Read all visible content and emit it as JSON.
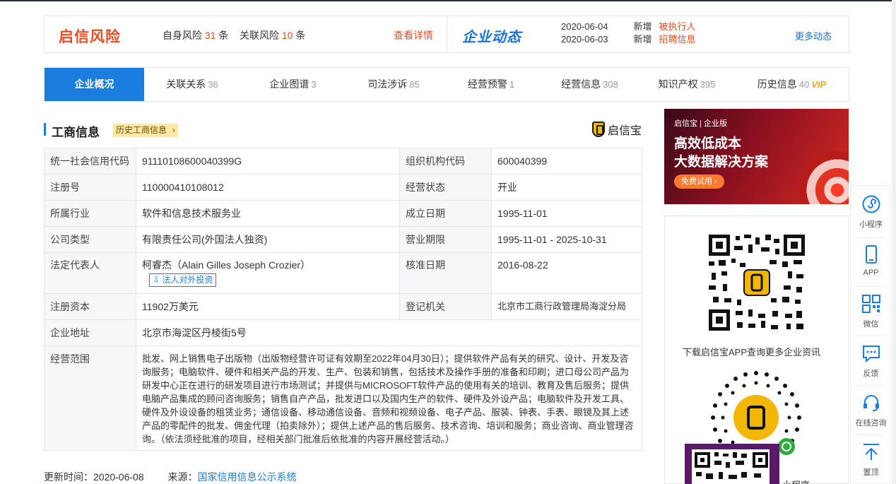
{
  "risk": {
    "logo": "启信风险",
    "self_label": "自身风险",
    "self_count": "31",
    "related_label": "关联风险",
    "related_count": "10",
    "unit": "条",
    "detail": "查看详情"
  },
  "dynamics": {
    "logo": "企业动态",
    "rows": [
      {
        "date": "2020-06-04",
        "tag": "新增",
        "text": "被执行人"
      },
      {
        "date": "2020-06-03",
        "tag": "新增",
        "text": "招聘信息"
      }
    ],
    "more": "更多动态"
  },
  "tabs": [
    {
      "label": "企业概况",
      "count": ""
    },
    {
      "label": "关联关系",
      "count": "36"
    },
    {
      "label": "企业图谱",
      "count": "3"
    },
    {
      "label": "司法涉诉",
      "count": "85"
    },
    {
      "label": "经营预警",
      "count": "1"
    },
    {
      "label": "经营信息",
      "count": "308"
    },
    {
      "label": "知识产权",
      "count": "395"
    },
    {
      "label": "历史信息",
      "count": "40",
      "badge": "VIP"
    }
  ],
  "section": {
    "title": "工商信息",
    "history_btn": "历史工商信息",
    "brand": "启信宝"
  },
  "info": {
    "credit_code_label": "统一社会信用代码",
    "credit_code": "91110108600040399G",
    "org_code_label": "组织机构代码",
    "org_code": "600040399",
    "reg_no_label": "注册号",
    "reg_no": "110000410108012",
    "status_label": "经营状态",
    "status": "开业",
    "industry_label": "所属行业",
    "industry": "软件和信息技术服务业",
    "founded_label": "成立日期",
    "founded": "1995-11-01",
    "type_label": "公司类型",
    "type": "有限责任公司(外国法人独资)",
    "term_label": "营业期限",
    "term": "1995-11-01 - 2025-10-31",
    "legal_label": "法定代表人",
    "legal": "柯睿杰（Alain Gilles Joseph Crozier）",
    "invest_btn": "法人对外投资",
    "approval_label": "核准日期",
    "approval": "2016-08-22",
    "capital_label": "注册资本",
    "capital": "11902万美元",
    "authority_label": "登记机关",
    "authority": "北京市工商行政管理局海淀分局",
    "address_label": "企业地址",
    "address": "北京市海淀区丹棱街5号",
    "scope_label": "经营范围",
    "scope": "批发、网上销售电子出版物（出版物经营许可证有效期至2022年04月30日）；提供软件产品有关的研究、设计、开发及咨询服务；电脑软件、硬件和相关产品的开发、生产、包装和销售，包括技术及操作手册的准备和印刷；进口母公司产品为研发中心正在进行的研发项目进行市场测试；并提供与MICROSOFT软件产品的使用有关的培训、教育及售后服务；提供电脑产品集成的顾问咨询服务；销售自产产品，批发进口以及国内生产的软件、硬件及外设产品；电脑软件及开发工具、硬件及外设设备的租赁业务；通信设备、移动通信设备、音频和视频设备、电子产品、服装、钟表、手表、眼镜及其上述产品的零配件的批发、佣金代理（拍卖除外）；提供上述产品的售后服务、技术咨询、培训和服务；商业咨询、商业管理咨询。（依法须经批准的项目，经相关部门批准后依批准的内容开展经营活动。）"
  },
  "footer": {
    "updated_label": "更新时间：",
    "updated": "2020-06-08",
    "source_label": "来源：",
    "source": "国家信用信息公示系统"
  },
  "banner": {
    "brand": "启信宝 | 企业版",
    "line1": "高效低成本",
    "line2": "大数据解决方案",
    "cta": "免费试用 ›"
  },
  "qr_panel": {
    "download_text": "下载启信宝APP查询更多企业资讯",
    "mini_text": "小程序"
  },
  "floatbar": {
    "items": [
      "小程序",
      "APP",
      "微信",
      "反馈",
      "在线咨询",
      "置顶"
    ]
  },
  "colors": {
    "accent": "#1c7de0",
    "risk": "#e54d26",
    "vip": "#f5a623"
  }
}
